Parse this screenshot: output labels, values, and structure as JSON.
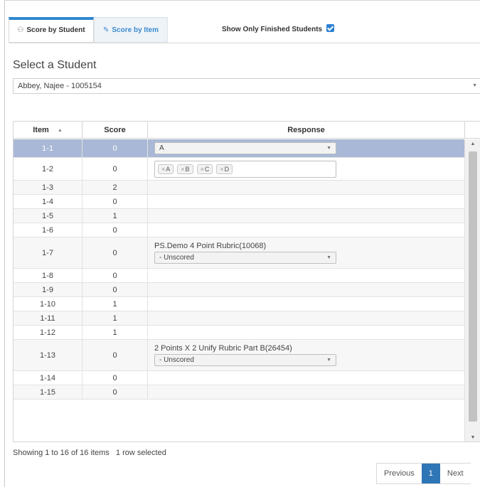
{
  "tabs": {
    "score_by_student": "Score by Student",
    "score_by_item": "Score by Item",
    "show_finished_label": "Show Only Finished Students",
    "show_finished_checked": true
  },
  "student_picker": {
    "title": "Select a Student",
    "selected": "Abbey, Najee - 1005154"
  },
  "grid": {
    "headers": {
      "item": "Item",
      "score": "Score",
      "response": "Response"
    },
    "rows": [
      {
        "item": "1-1",
        "score": "0",
        "response_type": "dropdown",
        "response_value": "A",
        "selected": true
      },
      {
        "item": "1-2",
        "score": "0",
        "response_type": "multi",
        "chips": [
          "A",
          "B",
          "C",
          "D"
        ]
      },
      {
        "item": "1-3",
        "score": "2"
      },
      {
        "item": "1-4",
        "score": "0"
      },
      {
        "item": "1-5",
        "score": "1"
      },
      {
        "item": "1-6",
        "score": "0"
      },
      {
        "item": "1-7",
        "score": "0",
        "response_type": "rubric",
        "rubric_label": "PS.Demo 4 Point Rubric(10068)",
        "rubric_value": "- Unscored"
      },
      {
        "item": "1-8",
        "score": "0"
      },
      {
        "item": "1-9",
        "score": "0"
      },
      {
        "item": "1-10",
        "score": "1"
      },
      {
        "item": "1-11",
        "score": "1"
      },
      {
        "item": "1-12",
        "score": "1"
      },
      {
        "item": "1-13",
        "score": "0",
        "response_type": "rubric",
        "rubric_label": "2 Points X 2 Unify Rubric Part B(26454)",
        "rubric_value": "- Unscored"
      },
      {
        "item": "1-14",
        "score": "0"
      },
      {
        "item": "1-15",
        "score": "0"
      }
    ]
  },
  "footer": {
    "status": "Showing 1 to 16 of 16 items   1 row selected",
    "pager": {
      "previous": "Previous",
      "current": "1",
      "next": "Next"
    }
  },
  "colors": {
    "accent": "#2f76b6",
    "selected_row": "#a9b8d6"
  }
}
